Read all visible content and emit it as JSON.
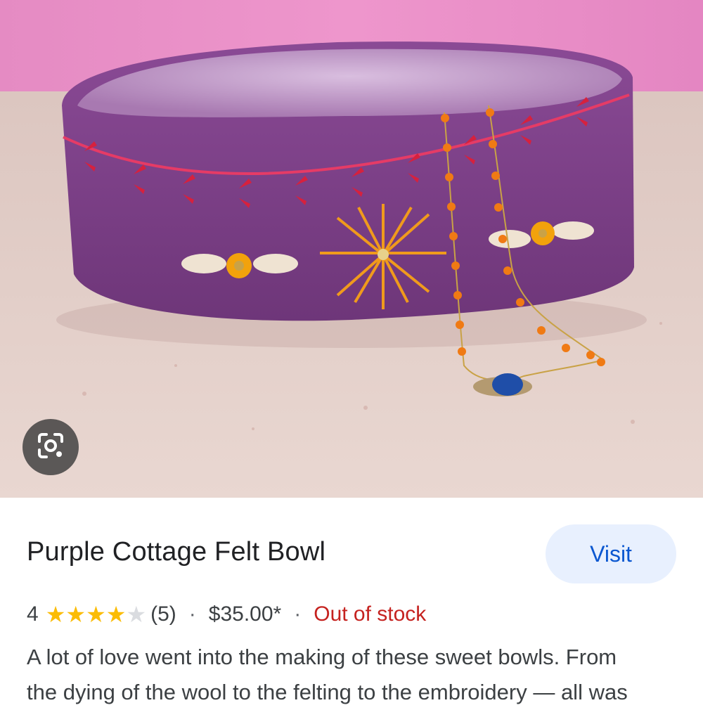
{
  "product": {
    "title": "Purple Cottage Felt Bowl",
    "visit_label": "Visit",
    "rating_value": "4",
    "rating_max": 5,
    "rating_stars_filled": 4,
    "review_count": "(5)",
    "separator": "·",
    "price": "$35.00*",
    "stock_status": "Out of stock",
    "description_lines": [
      "A lot of love went into the making of these sweet bowls. From",
      "the dying of the wool to the felting to the embroidery — all was"
    ]
  },
  "icons": {
    "lens": "google-lens-icon",
    "star": "star-icon"
  },
  "colors": {
    "visit_bg": "#e8f0fe",
    "visit_text": "#0b57d0",
    "star_filled": "#fbbc04",
    "star_empty": "#dadce0",
    "out_of_stock": "#c5221f",
    "bowl_purple": "#7a3e86"
  }
}
